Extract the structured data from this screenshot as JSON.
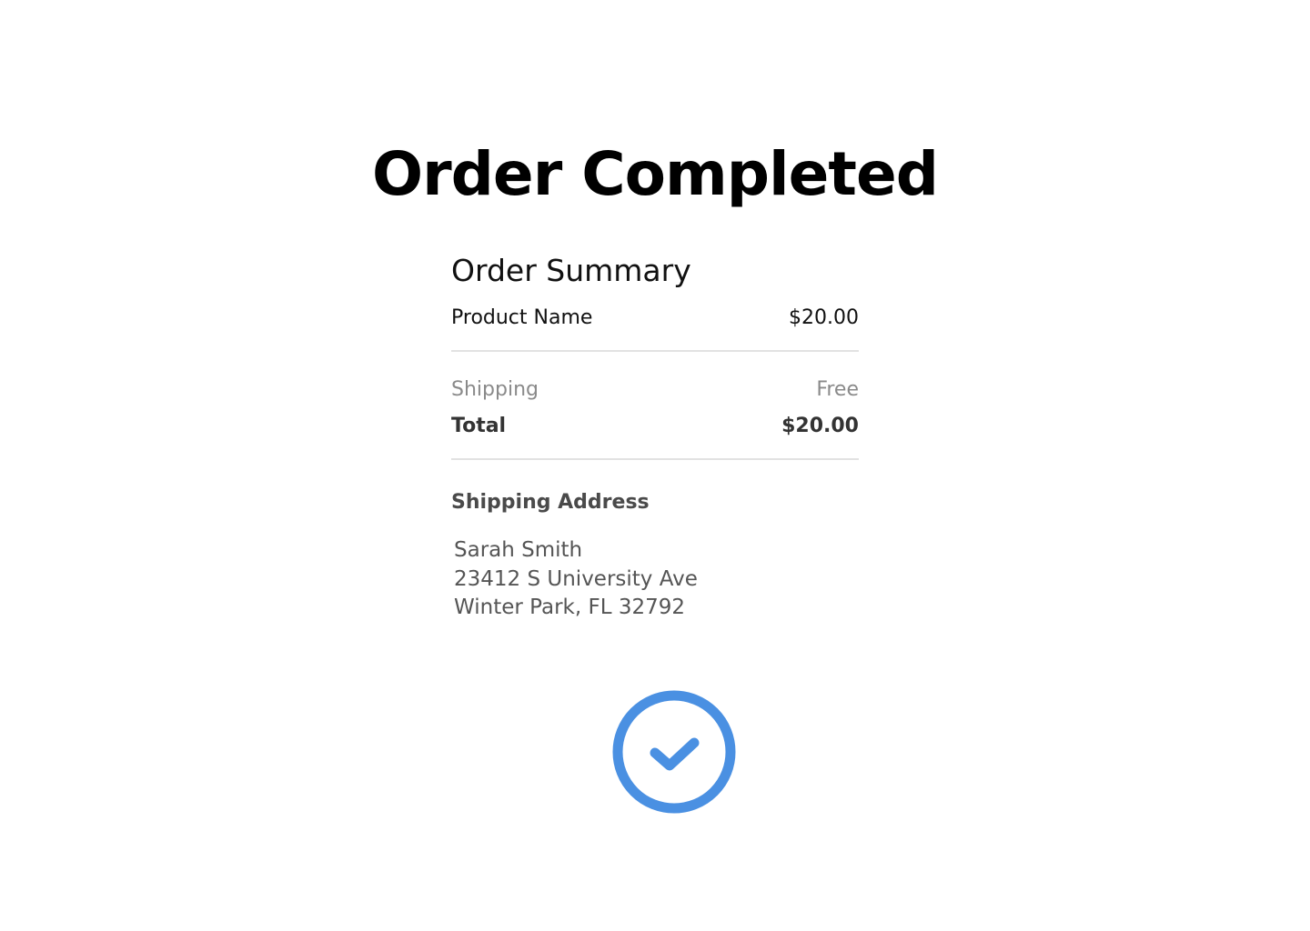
{
  "page_title": "Order Completed",
  "order_summary": {
    "heading": "Order Summary",
    "product": {
      "label": "Product Name",
      "price": "$20.00"
    },
    "shipping": {
      "label": "Shipping",
      "value": "Free"
    },
    "total": {
      "label": "Total",
      "value": "$20.00"
    }
  },
  "shipping_address": {
    "heading": "Shipping Address",
    "name": "Sarah Smith",
    "street": "23412 S University Ave",
    "city_line": "Winter Park, FL 32792"
  },
  "status_icon": {
    "name": "check-circle-icon",
    "color": "#4a90e2"
  }
}
